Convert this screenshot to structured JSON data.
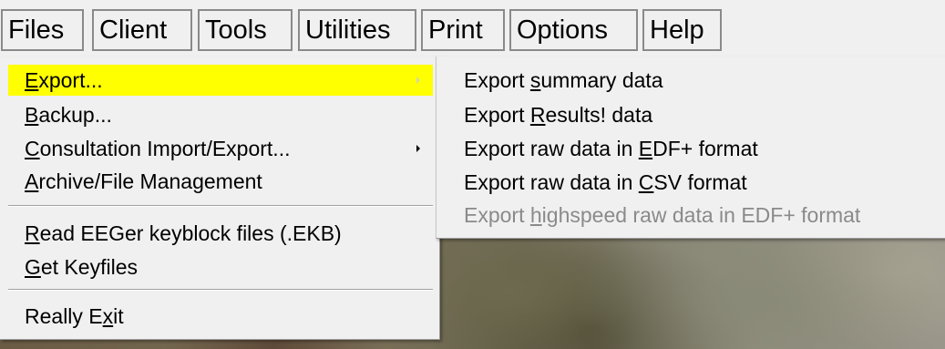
{
  "menubar": [
    {
      "label": "Files"
    },
    {
      "label": "Client"
    },
    {
      "label": "Tools"
    },
    {
      "label": "Utilities"
    },
    {
      "label": "Print"
    },
    {
      "label": "Options"
    },
    {
      "label": "Help"
    }
  ],
  "files_menu": {
    "items": [
      {
        "pre": "",
        "key": "E",
        "post": "xport...",
        "highlighted": true,
        "submenu": true
      },
      {
        "pre": "",
        "key": "B",
        "post": "ackup...",
        "submenu": false
      },
      {
        "pre": "",
        "key": "C",
        "post": "onsultation Import/Export...",
        "submenu": true
      },
      {
        "pre": "",
        "key": "A",
        "post": "rchive/File Management",
        "submenu": false
      },
      {
        "pre": "",
        "key": "R",
        "post": "ead EEGer keyblock files (.EKB)",
        "submenu": false
      },
      {
        "pre": "",
        "key": "G",
        "post": "et Keyfiles",
        "submenu": false
      },
      {
        "pre": "Really E",
        "key": "x",
        "post": "it",
        "submenu": false
      }
    ]
  },
  "export_submenu": {
    "items": [
      {
        "pre": "Export ",
        "key": "s",
        "post": "ummary data",
        "enabled": true
      },
      {
        "pre": "Export ",
        "key": "R",
        "post": "esults! data",
        "enabled": true
      },
      {
        "pre": "Export raw data in ",
        "key": "E",
        "post": "DF+ format",
        "enabled": true
      },
      {
        "pre": "Export raw data in ",
        "key": "C",
        "post": "SV format",
        "enabled": true
      },
      {
        "pre": "Export ",
        "key": "h",
        "post": "ighspeed raw data in EDF+ format",
        "enabled": false
      }
    ]
  },
  "colors": {
    "highlight": "#ffff00",
    "menu_bg": "#f0f0f0",
    "disabled_text": "#8a8a8a"
  }
}
